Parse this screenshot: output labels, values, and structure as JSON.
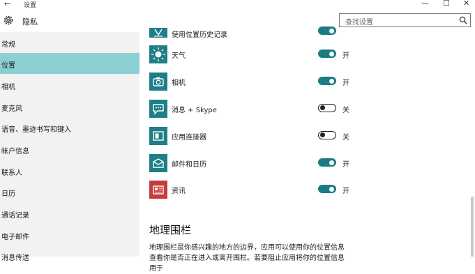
{
  "window": {
    "back": "←",
    "title": "设置",
    "minimize": "—",
    "maximize": "☐",
    "close": "✕"
  },
  "header": {
    "title": "隐私",
    "icon": "gear-icon",
    "search_placeholder": "查找设置"
  },
  "sidebar": {
    "items": [
      {
        "label": "常规"
      },
      {
        "label": "位置",
        "selected": true
      },
      {
        "label": "相机"
      },
      {
        "label": "麦克风"
      },
      {
        "label": "语音、墨迹书写和键入"
      },
      {
        "label": "帐户信息"
      },
      {
        "label": "联系人"
      },
      {
        "label": "日历"
      },
      {
        "label": "通话记录"
      },
      {
        "label": "电子邮件"
      },
      {
        "label": "消息传送"
      }
    ]
  },
  "apps": [
    {
      "name": "使用位置历史记录",
      "on": true,
      "state": ""
    },
    {
      "name": "天气",
      "on": true,
      "state": "开"
    },
    {
      "name": "相机",
      "on": true,
      "state": "开"
    },
    {
      "name": "消息 + Skype",
      "on": false,
      "state": "关"
    },
    {
      "name": "应用连接器",
      "on": false,
      "state": "关"
    },
    {
      "name": "邮件和日历",
      "on": true,
      "state": "开"
    },
    {
      "name": "资讯",
      "on": true,
      "state": "开"
    }
  ],
  "geofence": {
    "title": "地理围栏",
    "description": "地理围栏是你感兴趣的地方的边界，应用可以使用你的位置信息查看你是否正在进入或离开围栏。若要阻止应用将你的位置信息用于"
  },
  "colors": {
    "accent": "#1c7c85",
    "selected_nav": "#8ccfd2",
    "sidebar_bg": "#f2f2f2"
  }
}
